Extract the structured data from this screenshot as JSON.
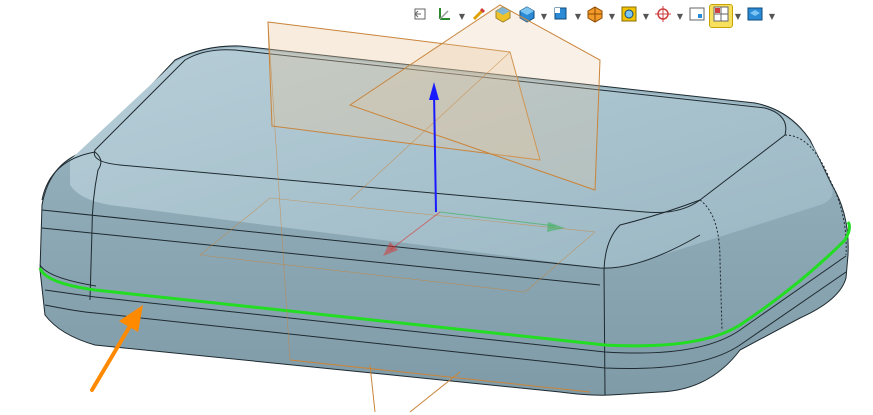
{
  "toolbar": {
    "items": [
      {
        "name": "view-back-icon",
        "dropdown": false
      },
      {
        "name": "orient-triad-icon",
        "dropdown": true
      },
      {
        "name": "pencil-edit-icon",
        "dropdown": false
      },
      {
        "name": "shaded-body-icon",
        "dropdown": false
      },
      {
        "name": "shaded-with-edges-icon",
        "dropdown": true
      },
      {
        "name": "view-orientation-icon",
        "dropdown": true
      },
      {
        "name": "section-view-icon",
        "dropdown": true
      },
      {
        "name": "zoom-fit-icon",
        "dropdown": true
      },
      {
        "name": "snap-target-icon",
        "dropdown": true
      },
      {
        "name": "display-window-icon",
        "dropdown": false
      },
      {
        "name": "split-view-icon",
        "dropdown": true,
        "active": true
      },
      {
        "name": "render-settings-icon",
        "dropdown": true
      }
    ]
  },
  "colors": {
    "part_top": "#a9c3ce",
    "part_side": "#8fabb7",
    "part_edge": "#1e2a30",
    "selected_edge": "#22dd22",
    "plane_edge": "#c9843a",
    "plane_fill": "#e8c9a0",
    "arrow": "#ff8a00",
    "axis_z": "#1a1aff",
    "axis_x": "#d83030",
    "axis_y": "#30b050"
  }
}
